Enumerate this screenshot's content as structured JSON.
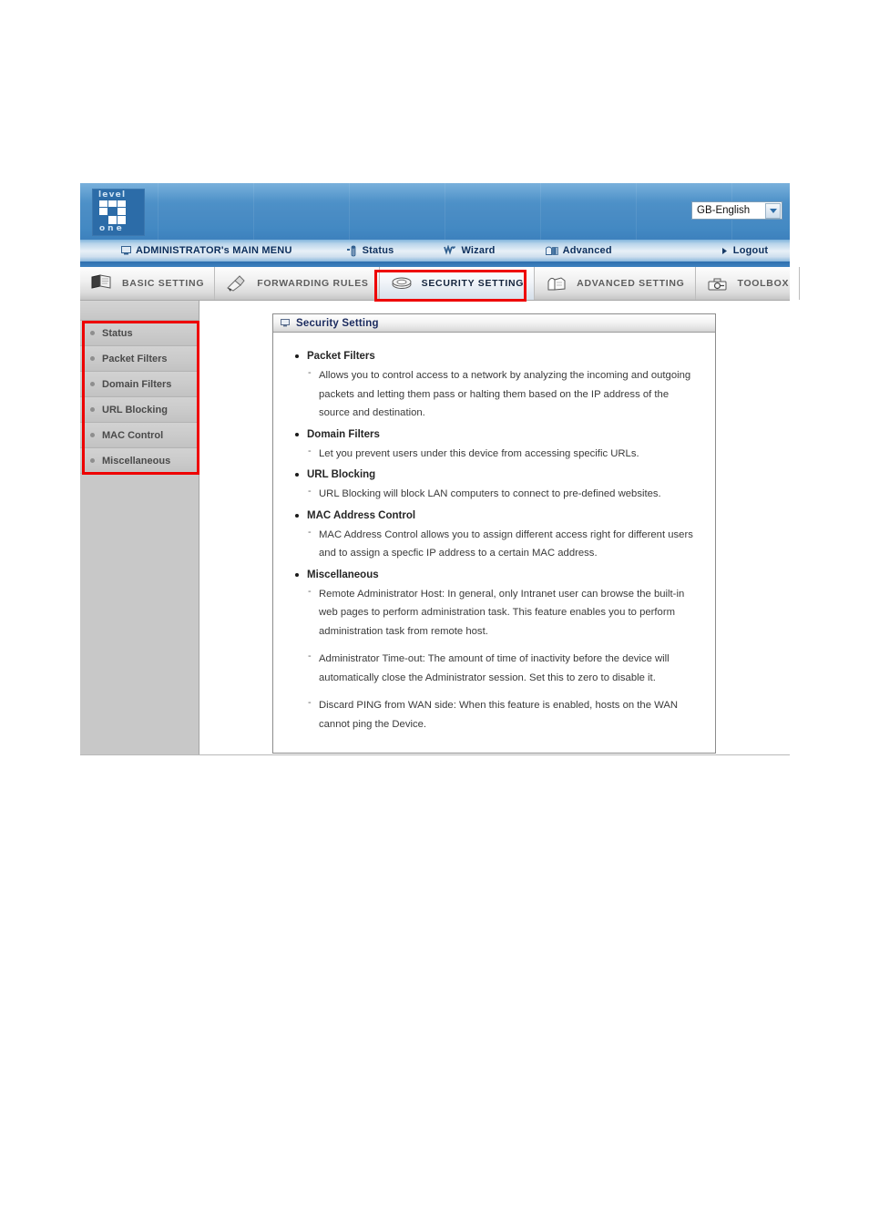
{
  "banner": {
    "logo_top": "level",
    "logo_bottom": "one",
    "language_selected": "GB-English",
    "language_options": [
      "GB-English"
    ]
  },
  "main_menu": {
    "items": [
      {
        "label": "ADMINISTRATOR's MAIN MENU",
        "icon": "monitor-icon"
      },
      {
        "label": "Status",
        "icon": "status-icon"
      },
      {
        "label": "Wizard",
        "icon": "wizard-icon"
      },
      {
        "label": "Advanced",
        "icon": "advanced-icon"
      },
      {
        "label": "Logout",
        "icon": "arrow-right-icon"
      }
    ]
  },
  "tabs": [
    {
      "label": "BASIC SETTING",
      "icon": "book-icon",
      "active": false
    },
    {
      "label": "FORWARDING RULES",
      "icon": "pencil-icon",
      "active": false
    },
    {
      "label": "SECURITY SETTING",
      "icon": "shield-icon",
      "active": true
    },
    {
      "label": "ADVANCED SETTING",
      "icon": "box-icon",
      "active": false
    },
    {
      "label": "TOOLBOX",
      "icon": "toolbox-icon",
      "active": false
    }
  ],
  "sidebar": {
    "items": [
      {
        "label": "Status"
      },
      {
        "label": "Packet Filters"
      },
      {
        "label": "Domain Filters"
      },
      {
        "label": "URL Blocking"
      },
      {
        "label": "MAC Control"
      },
      {
        "label": "Miscellaneous"
      }
    ]
  },
  "panel": {
    "title": "Security Setting",
    "sections": [
      {
        "heading": "Packet Filters",
        "items": [
          "Allows you to control access to a network by analyzing the incoming and outgoing packets and letting them pass or halting them based on the IP address of the source and destination."
        ]
      },
      {
        "heading": "Domain Filters",
        "items": [
          "Let you prevent users under this device from accessing specific URLs."
        ]
      },
      {
        "heading": "URL Blocking",
        "items": [
          "URL Blocking will block LAN computers to connect to pre-defined websites."
        ]
      },
      {
        "heading": "MAC Address Control",
        "items": [
          "MAC Address Control allows you to assign different access right for different users and to assign a specfic IP address to a certain MAC address."
        ]
      },
      {
        "heading": "Miscellaneous",
        "items": [
          "Remote Administrator Host: In general, only Intranet user can browse the built-in web pages to perform administration task. This feature enables you to perform administration task from remote host.",
          "Administrator Time-out: The amount of time of inactivity before the device will automatically close the Administrator session. Set this to zero to disable it.",
          "Discard PING from WAN side: When this feature is enabled, hosts on the WAN cannot ping the Device."
        ]
      }
    ]
  },
  "annotations": {
    "highlight_color": "#ee0000",
    "highlighted_tab": "SECURITY SETTING",
    "highlighted_menu": "sidebar menu items"
  }
}
